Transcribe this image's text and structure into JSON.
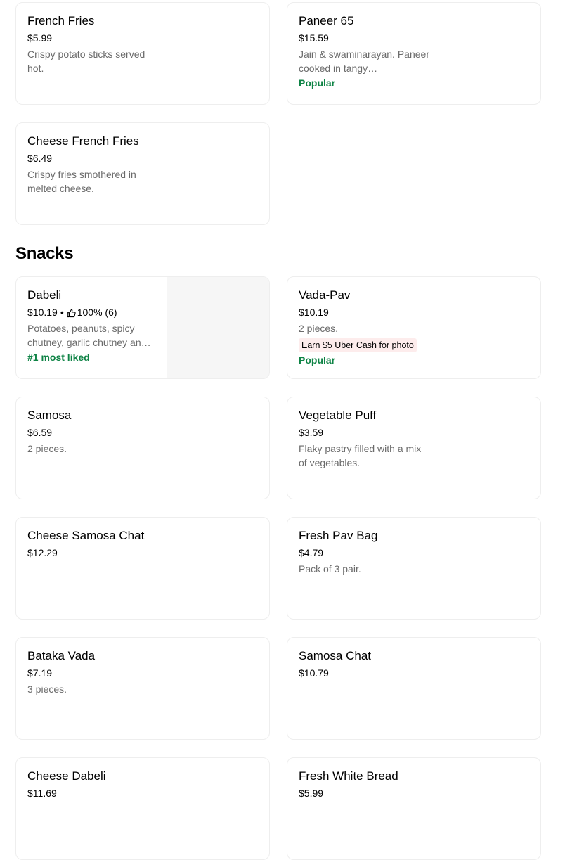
{
  "menu": {
    "top_items": [
      {
        "name": "French Fries",
        "price": "$5.99",
        "description": "Crispy potato sticks served hot."
      },
      {
        "name": "Paneer 65",
        "price": "$15.59",
        "description": "Jain & swaminarayan. Paneer cooked in tangy…",
        "badge": "Popular"
      },
      {
        "name": "Cheese French Fries",
        "price": "$6.49",
        "description": "Crispy fries smothered in melted cheese."
      }
    ],
    "snacks": {
      "title": "Snacks",
      "items": [
        {
          "name": "Dabeli",
          "price": "$10.19",
          "separator": "•",
          "rating": "100% (6)",
          "description": "Potatoes, peanuts, spicy chutney, garlic chutney an…",
          "badge": "#1 most liked",
          "rating_icon": "thumbs-up-icon"
        },
        {
          "name": "Vada-Pav",
          "price": "$10.19",
          "description": "2 pieces.",
          "promo": "Earn $5 Uber Cash for photo",
          "badge": "Popular"
        },
        {
          "name": "Samosa",
          "price": "$6.59",
          "description": "2 pieces."
        },
        {
          "name": "Vegetable Puff",
          "price": "$3.59",
          "description": "Flaky pastry filled with a mix of vegetables."
        },
        {
          "name": "Cheese Samosa Chat",
          "price": "$12.29"
        },
        {
          "name": "Fresh Pav Bag",
          "price": "$4.79",
          "description": "Pack of 3 pair."
        },
        {
          "name": "Bataka Vada",
          "price": "$7.19",
          "description": "3 pieces."
        },
        {
          "name": "Samosa Chat",
          "price": "$10.79"
        },
        {
          "name": "Cheese Dabeli",
          "price": "$11.69"
        },
        {
          "name": "Fresh White Bread",
          "price": "$5.99"
        }
      ]
    }
  },
  "colors": {
    "badge": "#0e8345",
    "promo_bg": "#fdecec",
    "muted_text": "#6b6b6b",
    "border": "#eeeeee"
  }
}
